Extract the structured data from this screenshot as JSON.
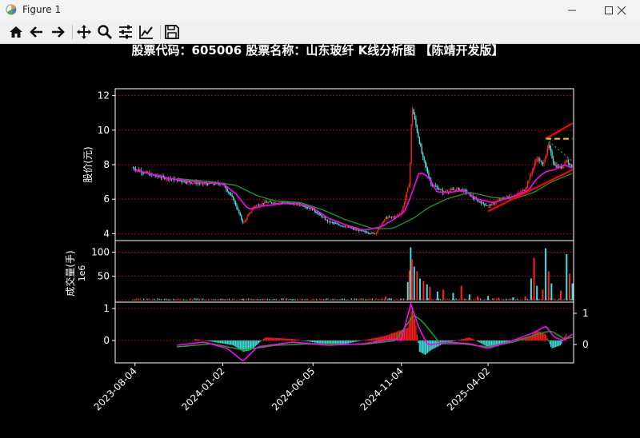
{
  "window": {
    "title": "Figure 1"
  },
  "toolbar": {
    "buttons": [
      "home-icon",
      "back-arrow-icon",
      "forward-arrow-icon",
      "pan-move-icon",
      "zoom-magnifier-icon",
      "configure-subplots-icon",
      "edit-axis-icon",
      "save-disk-icon"
    ]
  },
  "colors": {
    "background": "#000000",
    "frame": "#ffffff",
    "grid": "#cc0000",
    "up": "#ff2020",
    "down": "#40e0e0",
    "ma_fast": "#ff00ff",
    "ma_slow": "#1a9e1a",
    "trend": "#ff0000",
    "resistance": "#ffd700"
  },
  "chart_data": {
    "type": "candlestick",
    "title": "股票代码：605006 股票名称：山东玻纤   K线分析图 【陈靖开发版】",
    "x_tick_labels": [
      "2023-08-04",
      "2024-01-02",
      "2024-06-05",
      "2024-11-04",
      "2025-04-02"
    ],
    "x_range": [
      "2023-07-01",
      "2025-08-27"
    ],
    "price_panel": {
      "ylabel": "股价(元)",
      "yticks": [
        "4",
        "6",
        "8",
        "10",
        "12"
      ],
      "ylim": [
        3.6,
        12.4
      ],
      "grid": true,
      "close_path": [
        [
          "2023-08-01",
          7.8
        ],
        [
          "2023-09-01",
          7.4
        ],
        [
          "2023-10-01",
          7.2
        ],
        [
          "2023-11-01",
          7.0
        ],
        [
          "2023-12-01",
          6.9
        ],
        [
          "2024-01-02",
          6.9
        ],
        [
          "2024-01-20",
          6.0
        ],
        [
          "2024-02-06",
          4.6
        ],
        [
          "2024-02-25",
          5.6
        ],
        [
          "2024-03-15",
          5.8
        ],
        [
          "2024-04-15",
          5.8
        ],
        [
          "2024-05-15",
          5.7
        ],
        [
          "2024-06-05",
          5.4
        ],
        [
          "2024-07-01",
          4.7
        ],
        [
          "2024-08-01",
          4.4
        ],
        [
          "2024-09-01",
          4.1
        ],
        [
          "2024-09-20",
          4.0
        ],
        [
          "2024-10-08",
          4.9
        ],
        [
          "2024-10-25",
          5.0
        ],
        [
          "2024-11-04",
          5.2
        ],
        [
          "2024-11-18",
          7.0
        ],
        [
          "2024-11-22",
          11.4
        ],
        [
          "2024-12-10",
          8.5
        ],
        [
          "2024-12-25",
          6.9
        ],
        [
          "2025-01-15",
          6.4
        ],
        [
          "2025-02-10",
          6.6
        ],
        [
          "2025-02-25",
          6.4
        ],
        [
          "2025-03-10",
          6.0
        ],
        [
          "2025-04-02",
          5.6
        ],
        [
          "2025-04-15",
          5.8
        ],
        [
          "2025-05-01",
          6.1
        ],
        [
          "2025-05-20",
          6.2
        ],
        [
          "2025-06-05",
          6.6
        ],
        [
          "2025-06-25",
          8.4
        ],
        [
          "2025-07-05",
          8.0
        ],
        [
          "2025-07-15",
          9.1
        ],
        [
          "2025-07-25",
          8.0
        ],
        [
          "2025-08-05",
          7.8
        ],
        [
          "2025-08-15",
          8.3
        ],
        [
          "2025-08-25",
          7.8
        ]
      ],
      "ma_fast": [
        [
          "2023-08-01",
          7.7
        ],
        [
          "2023-10-01",
          7.2
        ],
        [
          "2023-12-01",
          6.95
        ],
        [
          "2024-01-02",
          6.9
        ],
        [
          "2024-01-25",
          6.3
        ],
        [
          "2024-02-15",
          5.4
        ],
        [
          "2024-03-10",
          5.6
        ],
        [
          "2024-04-15",
          5.75
        ],
        [
          "2024-05-15",
          5.7
        ],
        [
          "2024-06-05",
          5.5
        ],
        [
          "2024-07-01",
          4.9
        ],
        [
          "2024-08-01",
          4.5
        ],
        [
          "2024-09-01",
          4.2
        ],
        [
          "2024-10-01",
          4.4
        ],
        [
          "2024-10-25",
          4.9
        ],
        [
          "2024-11-10",
          5.3
        ],
        [
          "2024-11-25",
          6.6
        ],
        [
          "2024-12-05",
          7.6
        ],
        [
          "2024-12-20",
          7.3
        ],
        [
          "2025-01-05",
          6.4
        ],
        [
          "2025-01-25",
          6.4
        ],
        [
          "2025-02-20",
          6.5
        ],
        [
          "2025-03-15",
          6.0
        ],
        [
          "2025-04-10",
          5.8
        ],
        [
          "2025-05-10",
          6.1
        ],
        [
          "2025-06-10",
          6.5
        ],
        [
          "2025-06-25",
          7.2
        ],
        [
          "2025-07-10",
          7.6
        ],
        [
          "2025-07-25",
          7.7
        ],
        [
          "2025-08-10",
          8.0
        ],
        [
          "2025-08-25",
          7.8
        ]
      ],
      "ma_slow": [
        [
          "2023-10-15",
          7.2
        ],
        [
          "2023-12-15",
          7.0
        ],
        [
          "2024-01-25",
          6.8
        ],
        [
          "2024-03-01",
          6.2
        ],
        [
          "2024-04-01",
          5.9
        ],
        [
          "2024-05-15",
          5.8
        ],
        [
          "2024-06-20",
          5.4
        ],
        [
          "2024-08-01",
          4.8
        ],
        [
          "2024-09-15",
          4.3
        ],
        [
          "2024-10-20",
          4.3
        ],
        [
          "2024-11-25",
          4.9
        ],
        [
          "2024-12-20",
          5.5
        ],
        [
          "2025-01-20",
          6.0
        ],
        [
          "2025-03-01",
          6.4
        ],
        [
          "2025-04-10",
          6.1
        ],
        [
          "2025-05-15",
          6.0
        ],
        [
          "2025-06-20",
          6.4
        ],
        [
          "2025-07-20",
          7.0
        ],
        [
          "2025-08-25",
          7.5
        ]
      ],
      "trend_lines": [
        {
          "style": "solid-red",
          "from": [
            "2025-04-02",
            5.3
          ],
          "to": [
            "2025-08-25",
            7.7
          ]
        },
        {
          "style": "solid-red",
          "from": [
            "2025-07-10",
            9.5
          ],
          "to": [
            "2025-08-25",
            10.4
          ]
        },
        {
          "style": "dashed-yellow",
          "from": [
            "2025-07-10",
            9.5
          ],
          "to": [
            "2025-08-25",
            9.5
          ]
        },
        {
          "style": "dotted-green",
          "from": [
            "2025-07-10",
            9.5
          ],
          "to": [
            "2025-08-25",
            8.2
          ]
        }
      ]
    },
    "volume_panel": {
      "ylabel": "成交量(手)",
      "offset_label": "1e6",
      "yticks": [
        "50",
        "100"
      ],
      "ylim": [
        -4,
        124
      ],
      "grid": true,
      "bars": [
        [
          "2023-08-05",
          2
        ],
        [
          "2023-10-01",
          1
        ],
        [
          "2024-01-02",
          1
        ],
        [
          "2024-02-06",
          3
        ],
        [
          "2024-03-01",
          1
        ],
        [
          "2024-05-01",
          1
        ],
        [
          "2024-06-05",
          2
        ],
        [
          "2024-08-01",
          1
        ],
        [
          "2024-10-08",
          8
        ],
        [
          "2024-10-15",
          4
        ],
        [
          "2024-11-04",
          3
        ],
        [
          "2024-11-15",
          38
        ],
        [
          "2024-11-18",
          62
        ],
        [
          "2024-11-20",
          110
        ],
        [
          "2024-11-22",
          85
        ],
        [
          "2024-11-26",
          70
        ],
        [
          "2024-12-01",
          60
        ],
        [
          "2024-12-06",
          45
        ],
        [
          "2024-12-12",
          40
        ],
        [
          "2024-12-18",
          33
        ],
        [
          "2024-12-23",
          28
        ],
        [
          "2025-01-05",
          18
        ],
        [
          "2025-01-15",
          22
        ],
        [
          "2025-02-01",
          15
        ],
        [
          "2025-02-15",
          30
        ],
        [
          "2025-03-01",
          12
        ],
        [
          "2025-03-15",
          8
        ],
        [
          "2025-04-02",
          9
        ],
        [
          "2025-04-20",
          5
        ],
        [
          "2025-05-15",
          6
        ],
        [
          "2025-06-05",
          8
        ],
        [
          "2025-06-15",
          45
        ],
        [
          "2025-06-20",
          88
        ],
        [
          "2025-06-25",
          30
        ],
        [
          "2025-07-05",
          22
        ],
        [
          "2025-07-10",
          108
        ],
        [
          "2025-07-15",
          60
        ],
        [
          "2025-07-20",
          35
        ],
        [
          "2025-08-05",
          20
        ],
        [
          "2025-08-15",
          96
        ],
        [
          "2025-08-20",
          55
        ],
        [
          "2025-08-25",
          35
        ]
      ]
    },
    "indicator_panel": {
      "left_yticks": [
        "0",
        "1"
      ],
      "right_yticks": [
        "0",
        "1"
      ],
      "ylim": [
        -0.7,
        1.2
      ],
      "grid": true,
      "line_fast": [
        [
          "2023-10-15",
          -0.15
        ],
        [
          "2023-12-01",
          -0.05
        ],
        [
          "2024-01-10",
          -0.25
        ],
        [
          "2024-02-06",
          -0.65
        ],
        [
          "2024-03-01",
          -0.2
        ],
        [
          "2024-05-01",
          -0.05
        ],
        [
          "2024-07-01",
          -0.15
        ],
        [
          "2024-09-01",
          -0.1
        ],
        [
          "2024-10-20",
          0.05
        ],
        [
          "2024-11-04",
          0.0
        ],
        [
          "2024-11-20",
          1.15
        ],
        [
          "2024-12-05",
          0.35
        ],
        [
          "2024-12-20",
          -0.15
        ],
        [
          "2025-01-20",
          -0.05
        ],
        [
          "2025-03-01",
          -0.1
        ],
        [
          "2025-04-02",
          -0.25
        ],
        [
          "2025-05-15",
          0.0
        ],
        [
          "2025-06-20",
          0.25
        ],
        [
          "2025-07-10",
          0.45
        ],
        [
          "2025-07-25",
          0.1
        ],
        [
          "2025-08-10",
          0.0
        ],
        [
          "2025-08-25",
          0.2
        ]
      ],
      "line_slow": [
        [
          "2023-10-15",
          -0.2
        ],
        [
          "2023-12-15",
          -0.1
        ],
        [
          "2024-02-06",
          -0.3
        ],
        [
          "2024-04-01",
          -0.15
        ],
        [
          "2024-06-05",
          -0.1
        ],
        [
          "2024-09-01",
          -0.12
        ],
        [
          "2024-10-25",
          0.0
        ],
        [
          "2024-11-25",
          0.8
        ],
        [
          "2024-12-10",
          0.6
        ],
        [
          "2025-01-10",
          -0.1
        ],
        [
          "2025-02-15",
          -0.1
        ],
        [
          "2025-04-02",
          -0.2
        ],
        [
          "2025-05-15",
          -0.05
        ],
        [
          "2025-06-25",
          0.2
        ],
        [
          "2025-07-20",
          0.3
        ],
        [
          "2025-08-10",
          0.05
        ],
        [
          "2025-08-25",
          0.1
        ]
      ],
      "histogram": [
        [
          "2023-11-15",
          0.05
        ],
        [
          "2024-01-20",
          -0.15
        ],
        [
          "2024-02-06",
          -0.35
        ],
        [
          "2024-02-20",
          -0.3
        ],
        [
          "2024-03-15",
          0.1
        ],
        [
          "2024-05-01",
          0.05
        ],
        [
          "2024-06-20",
          -0.1
        ],
        [
          "2024-08-01",
          -0.1
        ],
        [
          "2024-10-08",
          0.15
        ],
        [
          "2024-11-15",
          0.4
        ],
        [
          "2024-11-22",
          1.0
        ],
        [
          "2024-11-28",
          0.6
        ],
        [
          "2024-12-05",
          -0.35
        ],
        [
          "2024-12-15",
          -0.45
        ],
        [
          "2024-12-25",
          -0.3
        ],
        [
          "2025-01-15",
          -0.1
        ],
        [
          "2025-03-01",
          0.1
        ],
        [
          "2025-04-02",
          -0.2
        ],
        [
          "2025-06-15",
          0.15
        ],
        [
          "2025-06-25",
          0.3
        ],
        [
          "2025-07-10",
          0.2
        ],
        [
          "2025-07-20",
          -0.25
        ],
        [
          "2025-08-05",
          -0.15
        ],
        [
          "2025-08-15",
          0.25
        ]
      ]
    }
  }
}
